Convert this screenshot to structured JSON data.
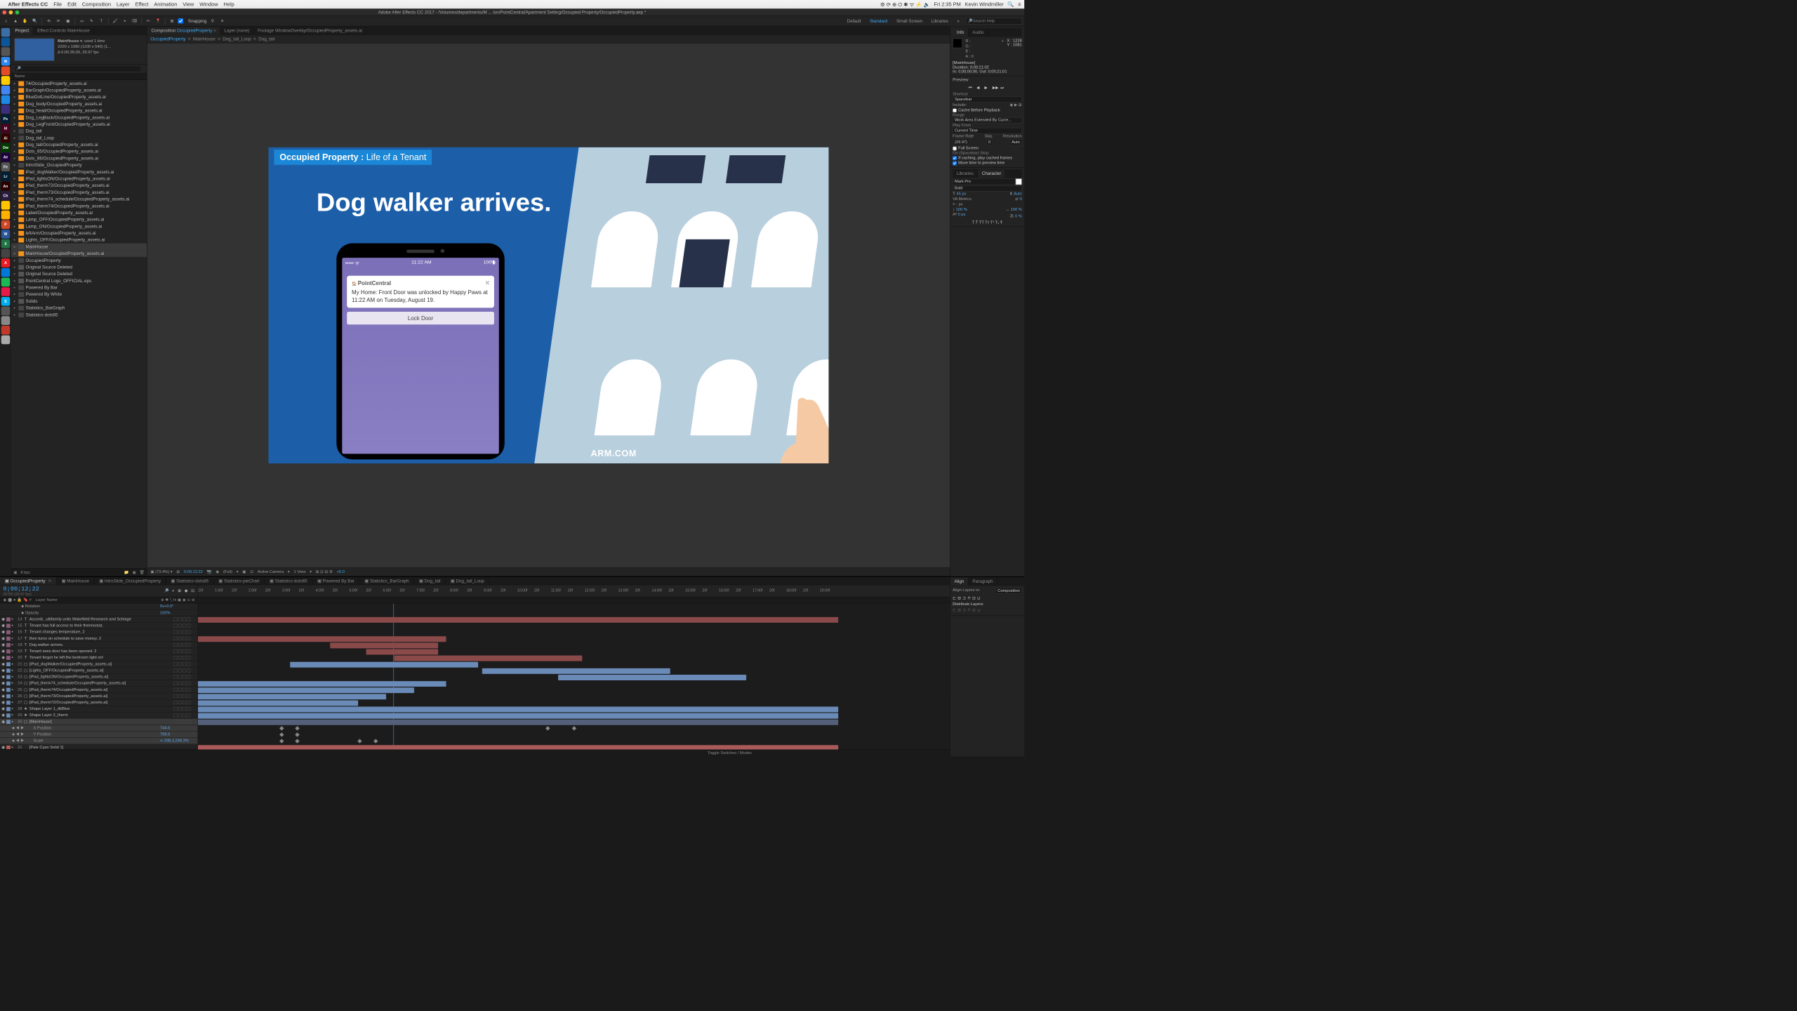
{
  "menubar": {
    "app": "After Effects CC",
    "items": [
      "File",
      "Edit",
      "Composition",
      "Layer",
      "Effect",
      "Animation",
      "View",
      "Window",
      "Help"
    ],
    "time": "Fri 2:35 PM",
    "user": "Kevin Windmiller"
  },
  "window_title": "Adobe After Effects CC 2017 - /Volumes/departments/M ... ion/PointCentral/Apartment Setting/Occupied Property/OccupiedProperty.aep *",
  "toolbar": {
    "snapping": "Snapping",
    "workspaces": [
      "Default",
      "Standard",
      "Small Screen",
      "Libraries"
    ],
    "active_workspace": "Standard",
    "search_placeholder": "Search Help"
  },
  "project_panel": {
    "tabs": [
      "Project",
      "Effect Controls MainHouse"
    ],
    "comp_name": "MainHouse",
    "comp_usage": "used 1 time",
    "comp_dims": "2200 x 1080 (1100 x 540) (1...",
    "comp_dur": "Δ 0;00;35;00, 29.97 fps",
    "col_name": "Name",
    "items": [
      {
        "name": "74/OccupiedProperty_assets.ai",
        "type": "ai"
      },
      {
        "name": "BarGraph/OccupiedProperty_assets.ai",
        "type": "ai"
      },
      {
        "name": "BlueDotLine/OccupiedProperty_assets.ai",
        "type": "ai"
      },
      {
        "name": "Dog_body/OccupiedProperty_assets.ai",
        "type": "ai"
      },
      {
        "name": "Dog_head/OccupiedProperty_assets.ai",
        "type": "ai"
      },
      {
        "name": "Dog_LegBack/OccupiedProperty_assets.ai",
        "type": "ai"
      },
      {
        "name": "Dog_LegFront/OccupiedProperty_assets.ai",
        "type": "ai"
      },
      {
        "name": "Dog_tail",
        "type": "comp"
      },
      {
        "name": "Dog_tail_Loop",
        "type": "comp"
      },
      {
        "name": "Dog_tail/OccupiedProperty_assets.ai",
        "type": "ai"
      },
      {
        "name": "Dots_65/OccupiedProperty_assets.ai",
        "type": "ai"
      },
      {
        "name": "Dots_86/OccupiedProperty_assets.ai",
        "type": "ai"
      },
      {
        "name": "IntroSlide_OccupiedProperty",
        "type": "comp"
      },
      {
        "name": "iPad_dogWalker/OccupiedProperty_assets.ai",
        "type": "ai"
      },
      {
        "name": "iPad_lightsON/OccupiedProperty_assets.ai",
        "type": "ai"
      },
      {
        "name": "iPad_therm72/OccupiedProperty_assets.ai",
        "type": "ai"
      },
      {
        "name": "iPad_therm73/OccupiedProperty_assets.ai",
        "type": "ai"
      },
      {
        "name": "iPad_therm74_schedule/OccupiedProperty_assets.ai",
        "type": "ai"
      },
      {
        "name": "iPad_therm74/OccupiedProperty_assets.ai",
        "type": "ai"
      },
      {
        "name": "Label/OccupiedProperty_assets.ai",
        "type": "ai"
      },
      {
        "name": "Lamp_OFF/OccupiedProperty_assets.ai",
        "type": "ai"
      },
      {
        "name": "Lamp_ON/OccupiedProperty_assets.ai",
        "type": "ai"
      },
      {
        "name": "leftArm/OccupiedProperty_assets.ai",
        "type": "ai"
      },
      {
        "name": "Lights_OFF/OccupiedProperty_assets.ai",
        "type": "ai"
      },
      {
        "name": "MainHouse",
        "type": "comp",
        "sel": true
      },
      {
        "name": "MainHouse/OccupiedProperty_assets.ai",
        "type": "ai",
        "sel": true
      },
      {
        "name": "OccupiedProperty",
        "type": "comp"
      },
      {
        "name": "Original Source Deleted",
        "type": "missing"
      },
      {
        "name": "Original Source Deleted",
        "type": "missing"
      },
      {
        "name": "PointCentral Logo_OFFICIAL.eps",
        "type": "eps"
      },
      {
        "name": "Powered By Bar",
        "type": "comp"
      },
      {
        "name": "Powered By White",
        "type": "comp"
      },
      {
        "name": "Solids",
        "type": "folder"
      },
      {
        "name": "Statistics_BarGraph",
        "type": "comp"
      },
      {
        "name": "Statistics-dots65",
        "type": "comp"
      }
    ],
    "footer_bpc": "8 bpc"
  },
  "center": {
    "tabs": [
      {
        "label": "Composition",
        "link": "OccupiedProperty",
        "active": true
      },
      {
        "label": "Layer (none)"
      },
      {
        "label": "Footage WindowOverlay/OccupiedProperty_assets.ai"
      }
    ],
    "breadcrumb": [
      "OccupiedProperty",
      "MainHouse",
      "Dog_tail_Loop",
      "Dog_tail"
    ],
    "canvas": {
      "tag_bold": "Occupied Property :",
      "tag_light": "Life of a Tenant",
      "headline": "Dog walker arrives.",
      "phone_time": "11:22 AM",
      "phone_battery": "100%",
      "notif_app": "PointCentral",
      "notif_body": "My Home: Front Door was unlocked by Happy Paws at 11:22 AM on Tuesday, August 19.",
      "lock_button": "Lock Door",
      "logo_text": "ARM.COM"
    },
    "footer": {
      "zoom": "(73.4%)",
      "timecode": "0;00;12;22",
      "res": "(Full)",
      "camera": "Active Camera",
      "views": "1 View",
      "exposure": "+0.0"
    }
  },
  "right": {
    "info": {
      "title": "Info",
      "audio_tab": "Audio",
      "x": "X : 1228",
      "y": "Y : 1081",
      "rgba": [
        "R :",
        "G :",
        "B :",
        "A : 0"
      ],
      "comp": "[MainHouse]",
      "duration": "Duration: 0;00;21;02",
      "inout": "In: 0;00;00;00, Out: 0;00;21;01"
    },
    "preview": {
      "title": "Preview",
      "shortcut_label": "Shortcut",
      "shortcut": "Spacebar",
      "include": "Include:",
      "cache": "Cache Before Playback",
      "range_label": "Range",
      "range": "Work Area Extended By Curre...",
      "playfrom_label": "Play From",
      "playfrom": "Current Time",
      "framerate_label": "Frame Rate",
      "skip_label": "Skip",
      "res_label": "Resolution",
      "framerate": "(29.97)",
      "skip": "0",
      "res": "Auto",
      "fullscreen": "Full Screen",
      "spacebar_stop": "On (Spacebar) Stop:",
      "caching": "If caching, play cached frames",
      "movetime": "Move time to preview time"
    },
    "libraries": "Libraries",
    "character": {
      "title": "Character",
      "font": "Mark Pro",
      "style": "Bold",
      "size": "45 px",
      "leading": "Auto",
      "kerning": "Metrics",
      "tracking": "0",
      "stroke": "- px",
      "vscale": "100 %",
      "hscale": "100 %",
      "baseline": "0 px",
      "tsume": "0 %"
    }
  },
  "timeline": {
    "tabs": [
      "OccupiedProperty",
      "MainHouse",
      "IntroSlide_OccupiedProperty",
      "Statistics-dots86",
      "Statistics-pieChart",
      "Statistics-dots65",
      "Powered By Bar",
      "Statistics_BarGraph",
      "Dog_tail",
      "Dog_tail_Loop"
    ],
    "timecode": "0;00;12;22",
    "frames": "00782 (29.97 fps)",
    "ruler_ticks": [
      "20f",
      "1:00f",
      "20f",
      "2:00f",
      "20f",
      "3:00f",
      "20f",
      "4:00f",
      "20f",
      "5:00f",
      "20f",
      "6:00f",
      "20f",
      "7:00f",
      "20f",
      "8:00f",
      "20f",
      "9:00f",
      "20f",
      "10:00f",
      "20f",
      "11:00f",
      "20f",
      "12:00f",
      "20f",
      "13:00f",
      "20f",
      "14:00f",
      "20f",
      "15:00f",
      "20f",
      "16:00f",
      "20f",
      "17:00f",
      "20f",
      "18:00f",
      "20f",
      "19:00f"
    ],
    "columns": "Layer Name",
    "sub_rotation": "Rotation",
    "sub_rotation_val": "0x+0.0°",
    "sub_opacity": "Opacity",
    "sub_opacity_val": "100%",
    "layers": [
      {
        "num": 14,
        "name": "Accordi...ultifamily units Wakefield Research and Schlage",
        "color": "#8b5a7a",
        "type": "T"
      },
      {
        "num": 15,
        "name": "Tenant has full access  to their thermostat.",
        "color": "#8b5a7a",
        "type": "T"
      },
      {
        "num": 16,
        "name": "Tenant changes temperature, 2",
        "color": "#8b5a7a",
        "type": "T"
      },
      {
        "num": 17,
        "name": "then turns on schedule  to save money. 2",
        "color": "#8b5a7a",
        "type": "T"
      },
      {
        "num": 18,
        "name": "Dog walker arrives.",
        "color": "#8b5a7a",
        "type": "T"
      },
      {
        "num": 19,
        "name": "Tenant sees door has been opened. 2",
        "color": "#8b5a7a",
        "type": "T"
      },
      {
        "num": 20,
        "name": "Tenant forgot he left the bedroom light on!",
        "color": "#8b5a7a",
        "type": "T"
      },
      {
        "num": 21,
        "name": "[iPad_dogWalker/OccupiedProperty_assets.ai]",
        "color": "#6a8bb8",
        "type": "▢"
      },
      {
        "num": 22,
        "name": "[Lights_OFF/OccupiedProperty_assets.ai]",
        "color": "#6a8bb8",
        "type": "▢"
      },
      {
        "num": 23,
        "name": "[iPad_lightsON/OccupiedProperty_assets.ai]",
        "color": "#6a8bb8",
        "type": "▢"
      },
      {
        "num": 24,
        "name": "[iPad_therm74_schedule/OccupiedProperty_assets.ai]",
        "color": "#6a8bb8",
        "type": "▢"
      },
      {
        "num": 25,
        "name": "[iPad_therm74/OccupiedProperty_assets.ai]",
        "color": "#6a8bb8",
        "type": "▢"
      },
      {
        "num": 26,
        "name": "[iPad_therm73/OccupiedProperty_assets.ai]",
        "color": "#6a8bb8",
        "type": "▢"
      },
      {
        "num": 27,
        "name": "[iPad_therm72/OccupiedProperty_assets.ai]",
        "color": "#6a8bb8",
        "type": "▢"
      },
      {
        "num": 28,
        "name": "Shape Layer 1_dkBlue",
        "color": "#6a8bb8",
        "type": "★"
      },
      {
        "num": 29,
        "name": "Shape Layer 2_therm",
        "color": "#6a8bb8",
        "type": "★"
      },
      {
        "num": 30,
        "name": "[MainHouse]",
        "color": "#6a8bb8",
        "type": "▢",
        "sel": true
      }
    ],
    "transform": [
      {
        "name": "X Position",
        "val": "744.6"
      },
      {
        "name": "Y Position",
        "val": "798.6"
      },
      {
        "name": "Scale",
        "val": "∞ 298.3,298.3%"
      }
    ],
    "last_layer": {
      "num": 31,
      "name": "[Pale Cyan Solid 1]",
      "color": "#b85a5a"
    },
    "footer": "Toggle Switches / Modes"
  },
  "align": {
    "title": "Align",
    "paragraph": "Paragraph",
    "align_to_label": "Align Layers to:",
    "align_to": "Composition",
    "distribute": "Distribute Layers:"
  },
  "dock_icons": [
    {
      "bg": "#3a6ea5",
      "t": ""
    },
    {
      "bg": "#0b5699",
      "t": ""
    },
    {
      "bg": "#555",
      "t": ""
    },
    {
      "bg": "#2d89ef",
      "t": "✉"
    },
    {
      "bg": "#e34c26",
      "t": ""
    },
    {
      "bg": "#ffcc00",
      "t": ""
    },
    {
      "bg": "#4285f4",
      "t": ""
    },
    {
      "bg": "#1e88e5",
      "t": ""
    },
    {
      "bg": "#3b2e7e",
      "t": ""
    },
    {
      "bg": "#001e36",
      "t": "Ps"
    },
    {
      "bg": "#49021f",
      "t": "Id"
    },
    {
      "bg": "#330000",
      "t": "Ai"
    },
    {
      "bg": "#003b00",
      "t": "Dw"
    },
    {
      "bg": "#1f0040",
      "t": "Ae"
    },
    {
      "bg": "#555",
      "t": "Fe"
    },
    {
      "bg": "#001e36",
      "t": "Lr"
    },
    {
      "bg": "#2a0000",
      "t": "An"
    },
    {
      "bg": "#2a1a40",
      "t": "Ch"
    },
    {
      "bg": "#ffc300",
      "t": ""
    },
    {
      "bg": "#ffb000",
      "t": ""
    },
    {
      "bg": "#d24726",
      "t": "P"
    },
    {
      "bg": "#2b579a",
      "t": "W"
    },
    {
      "bg": "#217346",
      "t": "X"
    },
    {
      "bg": "#444",
      "t": ""
    },
    {
      "bg": "#ed1c24",
      "t": "A"
    },
    {
      "bg": "#0078d7",
      "t": ""
    },
    {
      "bg": "#1db954",
      "t": ""
    },
    {
      "bg": "#e6194b",
      "t": ""
    },
    {
      "bg": "#00aff0",
      "t": "S"
    },
    {
      "bg": "#555",
      "t": ""
    },
    {
      "bg": "#888",
      "t": ""
    },
    {
      "bg": "#c0392b",
      "t": ""
    },
    {
      "bg": "#aaa",
      "t": ""
    }
  ]
}
